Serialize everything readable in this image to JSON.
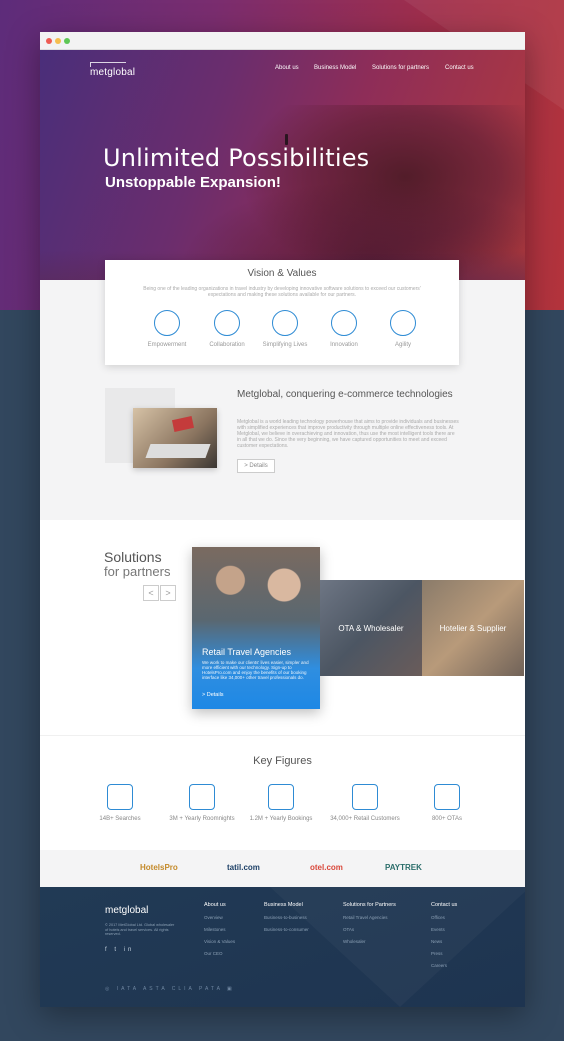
{
  "nav": {
    "logo": "metglobal",
    "items": [
      "About us",
      "Business Model",
      "Solutions for partners",
      "Contact us"
    ]
  },
  "hero": {
    "title": "Unlimited Possibilities",
    "subtitle": "Unstoppable Expansion!",
    "slides_total": 3,
    "active_slide": 3
  },
  "vision": {
    "title": "Vision & Values",
    "text": "Being one of the leading organizations in travel industry by developing innovative software solutions to exceed our customers' expectations and making these solutions available for our partners.",
    "values": [
      {
        "label": "Empowerment",
        "icon": "empowerment-icon"
      },
      {
        "label": "Collaboration",
        "icon": "handshake-icon"
      },
      {
        "label": "Simplifying Lives",
        "icon": "circles-icon"
      },
      {
        "label": "Innovation",
        "icon": "brain-icon"
      },
      {
        "label": "Agility",
        "icon": "arrows-up-icon"
      }
    ]
  },
  "about": {
    "title": "Metglobal, conquering e-commerce technologies",
    "text": "Metglobal is a world leading technology powerhouse that aims to provide individuals and businesses with simplified experiences that improve productivity through multiple online effectiveness tools. At Metglobal, we believe in overachieving and innovation, thus use the most intelligent tools there are in all that we do. Since the very beginning, we have captured opportunities to meet and exceed customer expectations.",
    "details": "> Details"
  },
  "solutions": {
    "title_line1": "Solutions",
    "title_line2": "for partners",
    "prev": "<",
    "next": ">",
    "featured": {
      "title": "Retail Travel Agencies",
      "text": "We work to make our clients' lives easier, simpler and more efficient with our technology. Sign-up to HotelsPro.com and enjoy the benefits of our booking interface like 34,000+ other travel professionals do.",
      "link": "> Details"
    },
    "tiles": [
      "OTA & Wholesaler",
      "Hotelier & Supplier"
    ]
  },
  "key_figures": {
    "title": "Key Figures",
    "items": [
      {
        "label": "14B+ Searches",
        "icon": "magnifier-icon"
      },
      {
        "label": "3M + Yearly Roomnights",
        "icon": "building-icon"
      },
      {
        "label": "1.2M + Yearly Bookings",
        "icon": "map-pin-building-icon"
      },
      {
        "label": "34,000+ Retail Customers",
        "icon": "people-icon"
      },
      {
        "label": "800+ OTAs",
        "icon": "storefront-icon"
      }
    ]
  },
  "partners": [
    {
      "name": "HotelsPro",
      "color": "#c48a2a"
    },
    {
      "name": "tatil.com",
      "color": "#1c3f66"
    },
    {
      "name": "otel.com",
      "color": "#d9473a"
    },
    {
      "name": "PAYTREK",
      "color": "#2a6d6a"
    }
  ],
  "footer": {
    "logo": "metglobal",
    "copyright": "© 2017 MetGlobal Ltd. Global wholesaler of hotels and travel services. All rights reserved.",
    "social": "f  t  in",
    "columns": [
      {
        "heading": "About us",
        "items": [
          "Overview",
          "Milestones",
          "Vision & Values",
          "Our CEO"
        ]
      },
      {
        "heading": "Business Model",
        "items": [
          "Business-to-business",
          "Business-to-consumer"
        ]
      },
      {
        "heading": "Solutions for Partners",
        "items": [
          "Retail Travel Agencies",
          "OTAs",
          "Wholesaler"
        ]
      },
      {
        "heading": "Contact us",
        "items": [
          "Offices",
          "Events",
          "News",
          "Press",
          "Careers"
        ]
      }
    ],
    "badges": "◎  IATA  ASTA  CLIA  PATA  ▣"
  }
}
